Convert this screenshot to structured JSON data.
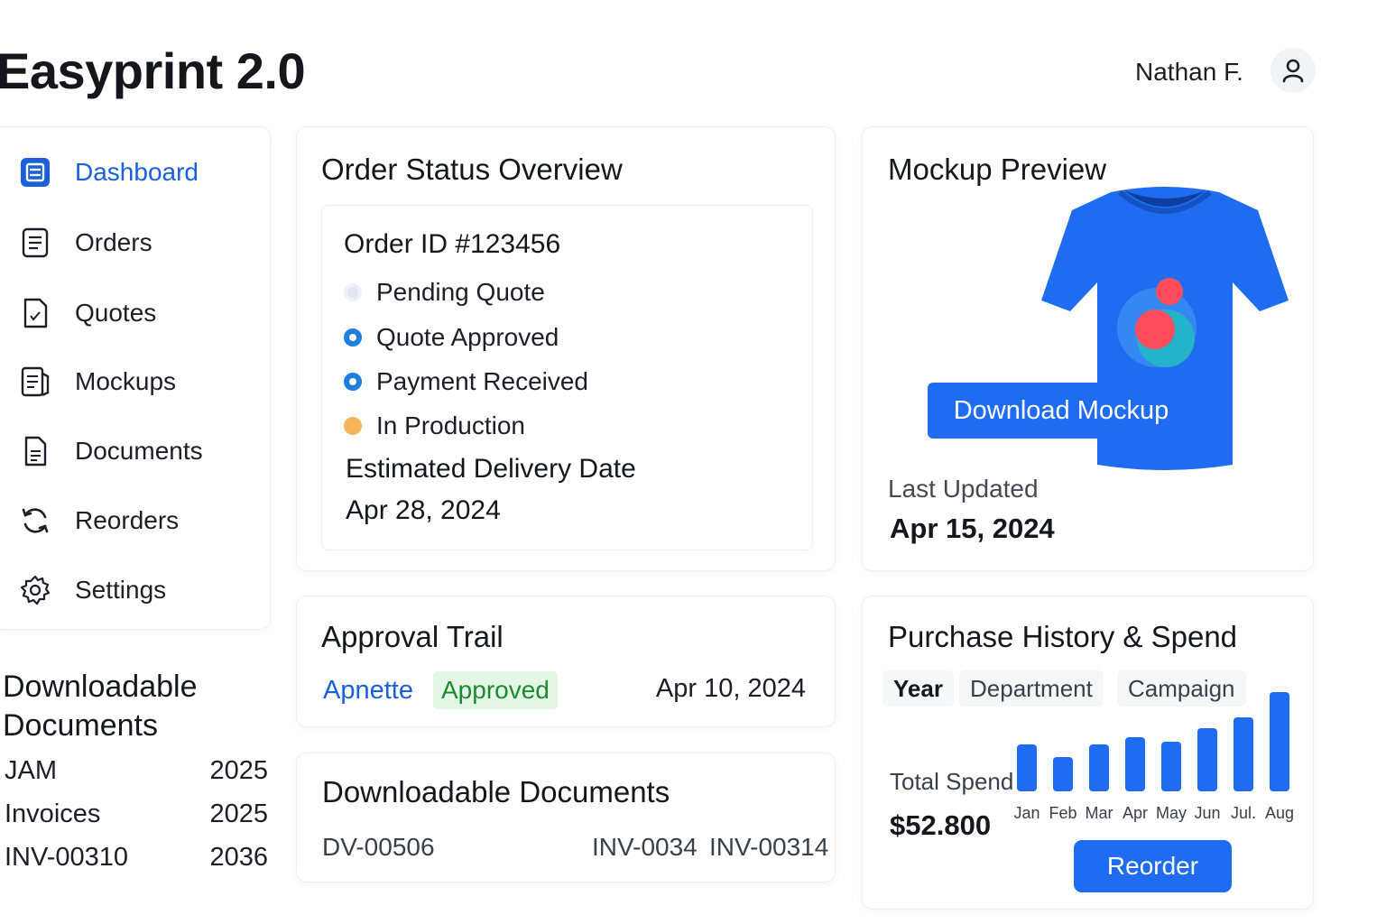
{
  "app": {
    "title": "Easyprint 2.0",
    "user_name": "Nathan F."
  },
  "sidebar": {
    "items": [
      {
        "label": "Dashboard",
        "icon": "dashboard-icon",
        "active": true
      },
      {
        "label": "Orders",
        "icon": "orders-icon"
      },
      {
        "label": "Quotes",
        "icon": "quotes-icon"
      },
      {
        "label": "Mockups",
        "icon": "mockups-icon"
      },
      {
        "label": "Documents",
        "icon": "documents-icon"
      },
      {
        "label": "Reorders",
        "icon": "refresh-icon"
      },
      {
        "label": "Settings",
        "icon": "gear-icon"
      }
    ]
  },
  "left_docs": {
    "title": "Downloadable Documents",
    "rows": [
      {
        "name": "JAM",
        "year": "2025"
      },
      {
        "name": "Invoices",
        "year": "2025"
      },
      {
        "name": "INV-00310",
        "year": "2036"
      }
    ]
  },
  "order_status": {
    "title": "Order Status Overview",
    "order_id": "Order ID #123456",
    "steps": [
      {
        "label": "Pending Quote",
        "state": "pending"
      },
      {
        "label": "Quote Approved",
        "state": "done"
      },
      {
        "label": "Payment Received",
        "state": "done"
      },
      {
        "label": "In Production",
        "state": "in-progress"
      }
    ],
    "estimated_label": "Estimated Delivery Date",
    "estimated_date": "Apr 28, 2024"
  },
  "mockup": {
    "title": "Mockup Preview",
    "download_label": "Download Mockup",
    "last_updated_label": "Last Updated",
    "last_updated_date": "Apr 15, 2024",
    "shirt_color": "#1f6cf0"
  },
  "approval": {
    "title": "Approval Trail",
    "approver": "Apnette",
    "status": "Approved",
    "date": "Apr 10, 2024"
  },
  "documents": {
    "title": "Downloadable Documents",
    "items": [
      "DV-00506",
      "INV-0034",
      "INV-00314"
    ]
  },
  "purchase": {
    "title": "Purchase History & Spend",
    "tabs": [
      "Year",
      "Department",
      "Campaign"
    ],
    "active_tab": "Year",
    "total_label": "Total Spend",
    "total_value": "$52.800",
    "reorder_label": "Reorder"
  },
  "chart_data": {
    "type": "bar",
    "categories": [
      "Jan",
      "Feb",
      "Mar",
      "Apr",
      "May",
      "Jun",
      "Jul.",
      "Aug"
    ],
    "values": [
      52,
      38,
      52,
      60,
      55,
      70,
      82,
      110
    ],
    "ylim": [
      0,
      110
    ],
    "grid": false,
    "bar_color": "#1f6cf0"
  },
  "colors": {
    "accent": "#1f6cf0",
    "link": "#1a5fdc",
    "success_bg": "#e4f6e6",
    "success_text": "#1c8a2f",
    "warning": "#f7b35b"
  }
}
